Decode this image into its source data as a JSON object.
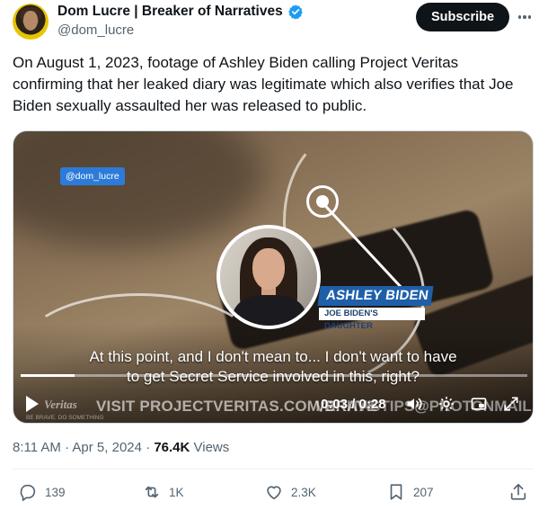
{
  "author": {
    "display_name": "Dom Lucre | Breaker of Narratives",
    "handle": "@dom_lucre",
    "verified": true
  },
  "header": {
    "subscribe_label": "Subscribe"
  },
  "tweet": {
    "text": "On August 1, 2023, footage of Ashley Biden calling Project Veritas confirming that her leaked diary was legitimate which also verifies that Joe Biden sexually assaulted her was released to public."
  },
  "video": {
    "watermark": "@dom_lucre",
    "name_tag": {
      "name": "ASHLEY BIDEN",
      "title": "JOE BIDEN'S DAUGHTER"
    },
    "caption_line1": "At this point, and I don't mean to... I don't want to have",
    "caption_line2": "to get Secret Service involved in this, right?",
    "brand_logo": "Veritas",
    "brand_tagline": "BE BRAVE. DO SOMETHING",
    "brand_url": "VISIT PROJECTVERITAS.COM/BRAVE",
    "brand_email": "VERITASTIPS@PROTONMAIL.COM",
    "timecode": "0:03 / 0:28",
    "progress_fraction": 0.107,
    "icons": [
      "play-icon",
      "volume-icon",
      "settings-icon",
      "pip-icon",
      "fullscreen-icon"
    ]
  },
  "meta": {
    "timestamp": "8:11 AM · Apr 5, 2024 · ",
    "views_count": "76.4K",
    "views_label": " Views"
  },
  "actions": {
    "replies": "139",
    "reposts": "1K",
    "likes": "2.3K",
    "bookmarks": "207"
  },
  "colors": {
    "verified_blue": "#1d9bf0",
    "text_primary": "#0f1419",
    "text_secondary": "#536471",
    "name_tag_blue": "#1f5fa8"
  }
}
